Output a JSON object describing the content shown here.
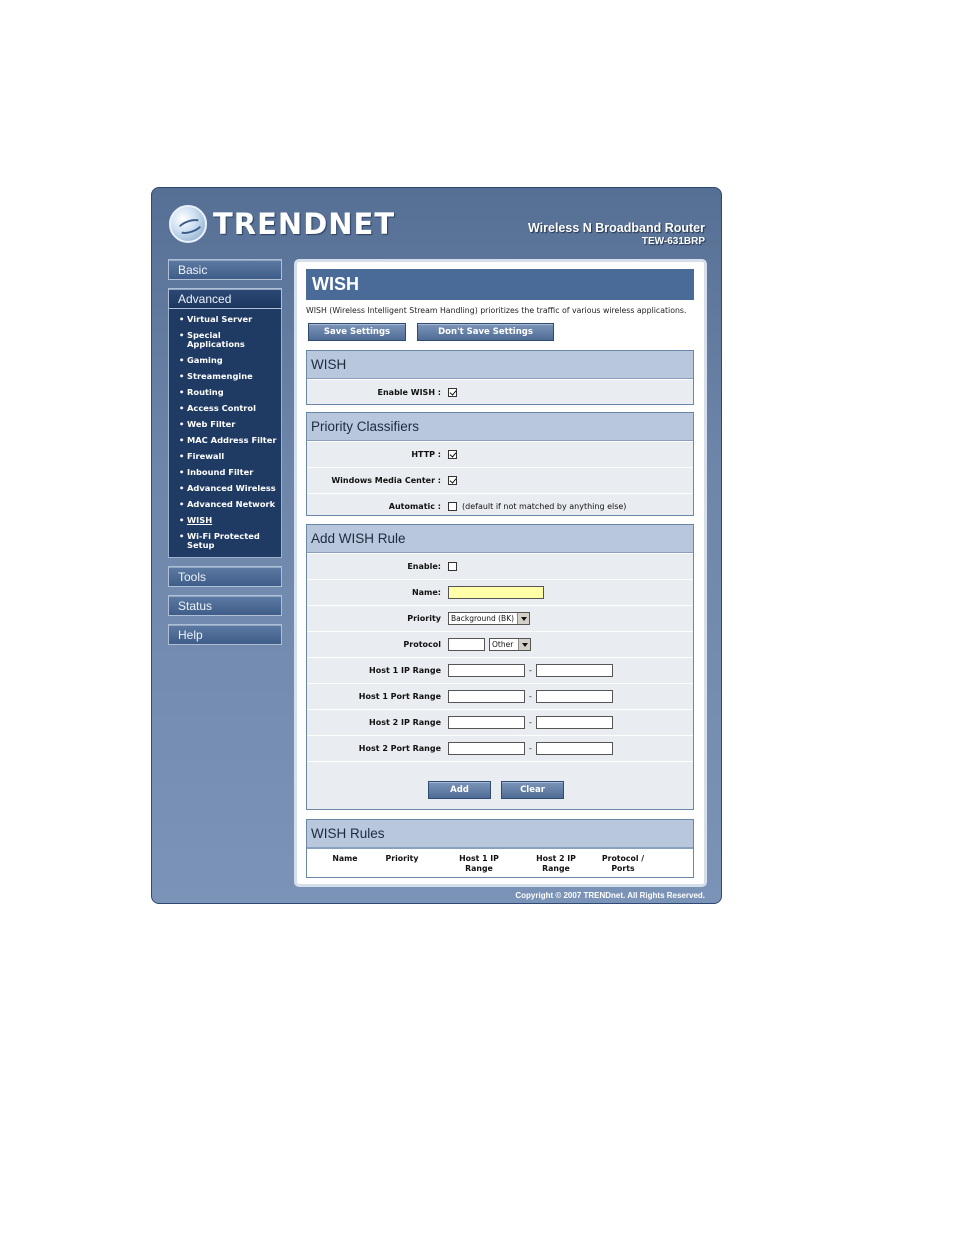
{
  "header": {
    "brand": "TRENDNET",
    "product_title": "Wireless N Broadband Router",
    "model": "TEW-631BRP"
  },
  "sidebar": {
    "basic": "Basic",
    "advanced": "Advanced",
    "items": [
      "Virtual Server",
      "Special Applications",
      "Gaming",
      "Streamengine",
      "Routing",
      "Access Control",
      "Web Filter",
      "MAC Address Filter",
      "Firewall",
      "Inbound Filter",
      "Advanced Wireless",
      "Advanced Network",
      "WISH",
      "Wi-Fi Protected Setup"
    ],
    "tools": "Tools",
    "status": "Status",
    "help": "Help"
  },
  "page": {
    "title": "WISH",
    "description": "WISH (Wireless Intelligent Stream Handling) prioritizes the traffic of various wireless applications.",
    "save_label": "Save Settings",
    "dont_save_label": "Don't Save Settings"
  },
  "wish": {
    "heading": "WISH",
    "enable_label": "Enable WISH :",
    "enable_checked": true
  },
  "classifiers": {
    "heading": "Priority Classifiers",
    "http_label": "HTTP :",
    "http_checked": true,
    "wmc_label": "Windows Media Center :",
    "wmc_checked": true,
    "auto_label": "Automatic :",
    "auto_checked": false,
    "auto_note": "(default if not matched by anything else)"
  },
  "add_rule": {
    "heading": "Add WISH Rule",
    "enable_label": "Enable:",
    "name_label": "Name:",
    "priority_label": "Priority",
    "priority_value": "Background (BK)",
    "protocol_label": "Protocol",
    "protocol_value": "Other",
    "host1_ip_label": "Host 1 IP Range",
    "host1_port_label": "Host 1 Port Range",
    "host2_ip_label": "Host 2 IP Range",
    "host2_port_label": "Host 2 Port Range",
    "range_sep": "-",
    "add_label": "Add",
    "clear_label": "Clear"
  },
  "rules": {
    "heading": "WISH Rules",
    "columns": [
      "Name",
      "Priority",
      "Host 1 IP Range",
      "Host 2 IP Range",
      "Protocol / Ports"
    ]
  },
  "footer": {
    "copyright": "Copyright © 2007 TRENDnet. All Rights Reserved."
  },
  "colors": {
    "frame": "#6e86aa",
    "title_bar": "#4a6b98",
    "section_head": "#b8c7db",
    "row_bg": "#e9ecf1",
    "name_field": "#ffffa8"
  }
}
